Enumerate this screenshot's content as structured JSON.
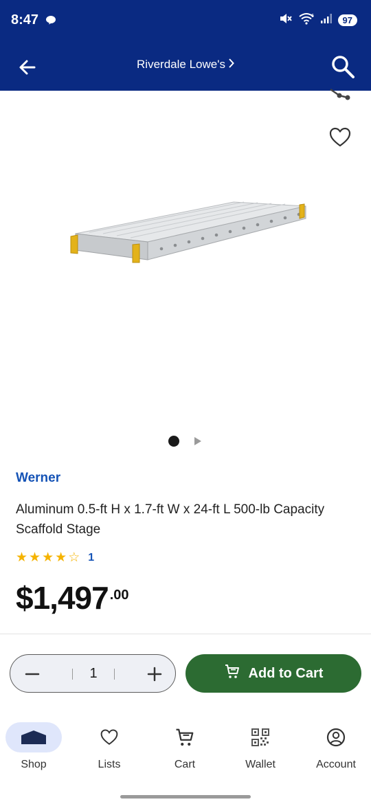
{
  "status": {
    "time": "8:47",
    "battery": "97",
    "signal_label": "6"
  },
  "header": {
    "store_name": "Riverdale Lowe's"
  },
  "product": {
    "brand": "Werner",
    "title": "Aluminum 0.5-ft H x 1.7-ft W x 24-ft L 500-lb Capacity Scaffold Stage",
    "rating": 4,
    "rating_max": 5,
    "review_count": "1",
    "price_main": "$1,497",
    "price_cents": ".00"
  },
  "quantity": {
    "value": "1"
  },
  "actions": {
    "add_to_cart_label": "Add to Cart"
  },
  "nav": {
    "items": [
      {
        "label": "Shop",
        "icon": "shop-icon"
      },
      {
        "label": "Lists",
        "icon": "heart-icon"
      },
      {
        "label": "Cart",
        "icon": "cart-icon"
      },
      {
        "label": "Wallet",
        "icon": "qr-icon"
      },
      {
        "label": "Account",
        "icon": "account-icon"
      }
    ]
  },
  "colors": {
    "header_bg": "#0a2a82",
    "brand_link": "#1553b6",
    "cart_button": "#2c6b32",
    "star": "#f5b300"
  }
}
